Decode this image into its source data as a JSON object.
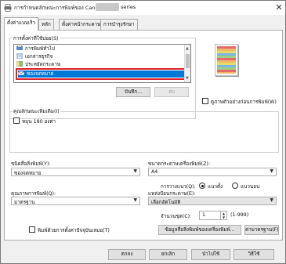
{
  "window": {
    "title_prefix": "การกำหนดลักษณะการพิมพ์ของ Canon",
    "title_suffix": "series",
    "close_glyph": "✕"
  },
  "tabs": [
    {
      "label": "ตั้งค่าแบบเร็ว",
      "active": true
    },
    {
      "label": "หลัก",
      "active": false
    },
    {
      "label": "ตั้งค่าหน้ากระดาษ",
      "active": false
    },
    {
      "label": "การบำรุงรักษา",
      "active": false
    }
  ],
  "common_settings": {
    "label": "การตั้งค่าที่ใช้บ่อย(S)",
    "items": [
      {
        "label": "การพิมพ์ทั่วไป",
        "icon": "printer-icon",
        "selected": false
      },
      {
        "label": "เอกสารธุรกิจ",
        "icon": "document-icon",
        "selected": false
      },
      {
        "label": "ประหยัดกระดาษ",
        "icon": "paper-icon",
        "selected": false
      },
      {
        "label": "ซองจดหมาย",
        "icon": "envelope-icon",
        "selected": true
      }
    ],
    "save_button": "บันทึก...",
    "delete_button": "ลบ"
  },
  "preview": {
    "always_show_label": "ดูภาพตัวอย่างก่อนการพิมพ์(W)"
  },
  "additional_features": {
    "label": "คุณลักษณะเพิ่มเติม(I)",
    "rotate_label": "หมุน 180 องศา"
  },
  "media_type": {
    "label": "ชนิดสื่อสิ่งพิมพ์(Y):",
    "value": "ซองจดหมาย"
  },
  "printer_paper_size": {
    "label": "ขนาดกระดาษเครื่องพิมพ์(Z):",
    "value": "A4"
  },
  "orientation": {
    "label": "การวางแนว(Q):",
    "portrait": "แนวตั้ง",
    "landscape": "แนวนอน",
    "selected": "portrait"
  },
  "print_quality": {
    "label": "คุณภาพการพิมพ์(Q):",
    "value": "มาตรฐาน"
  },
  "paper_source": {
    "label": "แหล่งป้อนกระดาษ(E):",
    "value": "เลือกอัตโนมัติ"
  },
  "copies": {
    "label": "จำนวนชุด(C):",
    "value": "1",
    "range": "(1-999)"
  },
  "always_print_current": {
    "label": "พิมพ์ด้วยการตั้งค่าปัจจุบันเสมอ(T)"
  },
  "printer_media_info_button": "ข้อมูลสื่อสิ่งพิมพ์ของเครื่องพิมพ์...",
  "defaults_button": "ค่ามาตรฐาน(F)",
  "dialog_buttons": {
    "ok": "ตกลง",
    "cancel": "ยกเลิก",
    "apply": "นำไปใช้",
    "help": "วิธีใช้"
  }
}
